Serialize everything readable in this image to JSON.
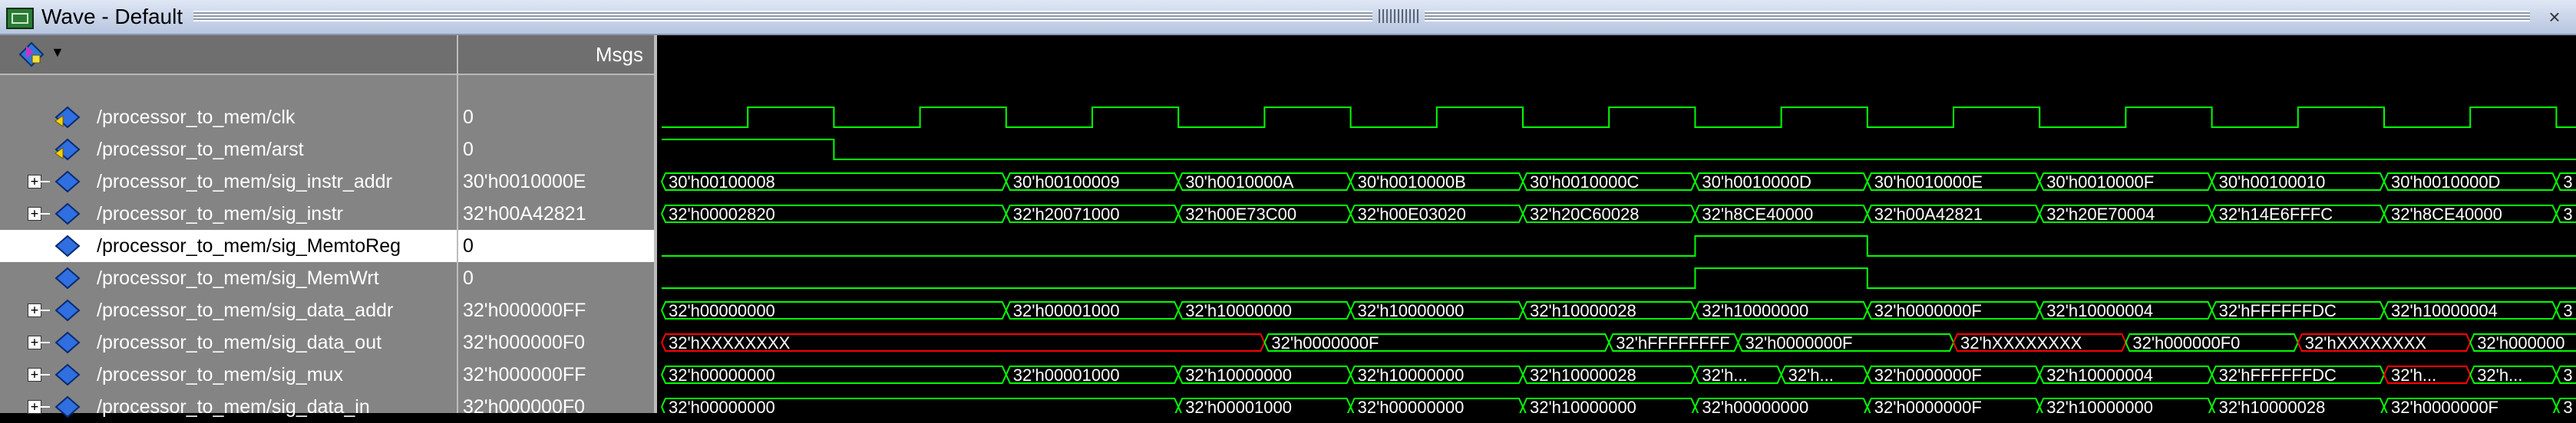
{
  "window": {
    "title": "Wave - Default"
  },
  "header": {
    "values_label": "Msgs"
  },
  "signals": [
    {
      "name": "/processor_to_mem/clk",
      "value": "0",
      "kind": "bit",
      "expandable": false,
      "icon": "signal-input-icon"
    },
    {
      "name": "/processor_to_mem/arst",
      "value": "0",
      "kind": "bit",
      "expandable": false,
      "icon": "signal-input-icon"
    },
    {
      "name": "/processor_to_mem/sig_instr_addr",
      "value": "30'h0010000E",
      "kind": "bus",
      "expandable": true,
      "icon": "signal-icon"
    },
    {
      "name": "/processor_to_mem/sig_instr",
      "value": "32'h00A42821",
      "kind": "bus",
      "expandable": true,
      "icon": "signal-icon"
    },
    {
      "name": "/processor_to_mem/sig_MemtoReg",
      "value": "0",
      "kind": "bit",
      "expandable": false,
      "icon": "signal-icon",
      "selected": true
    },
    {
      "name": "/processor_to_mem/sig_MemWrt",
      "value": "0",
      "kind": "bit",
      "expandable": false,
      "icon": "signal-icon"
    },
    {
      "name": "/processor_to_mem/sig_data_addr",
      "value": "32'h000000FF",
      "kind": "bus",
      "expandable": true,
      "icon": "signal-icon"
    },
    {
      "name": "/processor_to_mem/sig_data_out",
      "value": "32'h000000F0",
      "kind": "bus",
      "expandable": true,
      "icon": "signal-icon"
    },
    {
      "name": "/processor_to_mem/sig_mux",
      "value": "32'h000000FF",
      "kind": "bus",
      "expandable": true,
      "icon": "signal-icon"
    },
    {
      "name": "/processor_to_mem/sig_data_in",
      "value": "32'h000000F0",
      "kind": "bus",
      "expandable": true,
      "icon": "signal-icon"
    }
  ],
  "colors": {
    "wave": "#00ff00",
    "undefined": "#ff0000",
    "background": "#000000",
    "panel": "#848484"
  },
  "waves": {
    "clk_period_ns": 20,
    "clk_first_high_ns": 10,
    "visible_end_ns": 230,
    "arst": {
      "high_until_ns": 20
    },
    "sig_MemtoReg": {
      "low": [
        0,
        120
      ],
      "high": [
        120,
        140
      ],
      "low2": [
        140,
        230
      ]
    },
    "sig_MemWrt": {
      "low": [
        0,
        120
      ],
      "high": [
        120,
        140
      ],
      "low2": [
        140,
        230
      ]
    },
    "buses": {
      "sig_instr_addr": [
        {
          "t": 0,
          "v": "30'h00100008"
        },
        {
          "t": 40,
          "v": "30'h00100009"
        },
        {
          "t": 60,
          "v": "30'h0010000A"
        },
        {
          "t": 80,
          "v": "30'h0010000B"
        },
        {
          "t": 100,
          "v": "30'h0010000C"
        },
        {
          "t": 120,
          "v": "30'h0010000D"
        },
        {
          "t": 140,
          "v": "30'h0010000E"
        },
        {
          "t": 160,
          "v": "30'h0010000F"
        },
        {
          "t": 180,
          "v": "30'h00100010"
        },
        {
          "t": 200,
          "v": "30'h0010000D"
        },
        {
          "t": 220,
          "v": "3"
        }
      ],
      "sig_instr": [
        {
          "t": 0,
          "v": "32'h00002820"
        },
        {
          "t": 40,
          "v": "32'h20071000"
        },
        {
          "t": 60,
          "v": "32'h00E73C00"
        },
        {
          "t": 80,
          "v": "32'h00E03020"
        },
        {
          "t": 100,
          "v": "32'h20C60028"
        },
        {
          "t": 120,
          "v": "32'h8CE40000"
        },
        {
          "t": 140,
          "v": "32'h00A42821"
        },
        {
          "t": 160,
          "v": "32'h20E70004"
        },
        {
          "t": 180,
          "v": "32'h14E6FFFC"
        },
        {
          "t": 200,
          "v": "32'h8CE40000"
        },
        {
          "t": 220,
          "v": "3"
        }
      ],
      "sig_data_addr": [
        {
          "t": 0,
          "v": "32'h00000000"
        },
        {
          "t": 40,
          "v": "32'h00001000"
        },
        {
          "t": 60,
          "v": "32'h10000000"
        },
        {
          "t": 80,
          "v": "32'h10000000"
        },
        {
          "t": 100,
          "v": "32'h10000028"
        },
        {
          "t": 120,
          "v": "32'h10000000"
        },
        {
          "t": 140,
          "v": "32'h0000000F"
        },
        {
          "t": 160,
          "v": "32'h10000004"
        },
        {
          "t": 180,
          "v": "32'hFFFFFFDC"
        },
        {
          "t": 200,
          "v": "32'h10000004"
        },
        {
          "t": 220,
          "v": "3"
        }
      ],
      "sig_data_out": [
        {
          "t": 0,
          "v": "32'hXXXXXXXX",
          "x": true
        },
        {
          "t": 70,
          "v": "32'h0000000F"
        },
        {
          "t": 110,
          "v": "32'hFFFFFFFF"
        },
        {
          "t": 125,
          "v": "32'h0000000F"
        },
        {
          "t": 150,
          "v": "32'hXXXXXXXX",
          "x": true
        },
        {
          "t": 170,
          "v": "32'h000000F0"
        },
        {
          "t": 190,
          "v": "32'hXXXXXXXX",
          "x": true
        },
        {
          "t": 210,
          "v": "32'h000000"
        }
      ],
      "sig_mux": [
        {
          "t": 0,
          "v": "32'h00000000"
        },
        {
          "t": 40,
          "v": "32'h00001000"
        },
        {
          "t": 60,
          "v": "32'h10000000"
        },
        {
          "t": 80,
          "v": "32'h10000000"
        },
        {
          "t": 100,
          "v": "32'h10000028"
        },
        {
          "t": 120,
          "v": "32'h..."
        },
        {
          "t": 130,
          "v": "32'h..."
        },
        {
          "t": 140,
          "v": "32'h0000000F"
        },
        {
          "t": 160,
          "v": "32'h10000004"
        },
        {
          "t": 180,
          "v": "32'hFFFFFFDC"
        },
        {
          "t": 200,
          "v": "32'h...",
          "x": true
        },
        {
          "t": 210,
          "v": "32'h..."
        },
        {
          "t": 220,
          "v": "3"
        }
      ],
      "sig_data_in": [
        {
          "t": 0,
          "v": "32'h00000000"
        },
        {
          "t": 60,
          "v": "32'h00001000"
        },
        {
          "t": 80,
          "v": "32'h00000000"
        },
        {
          "t": 100,
          "v": "32'h10000000"
        },
        {
          "t": 120,
          "v": "32'h00000000"
        },
        {
          "t": 140,
          "v": "32'h0000000F"
        },
        {
          "t": 160,
          "v": "32'h10000000"
        },
        {
          "t": 180,
          "v": "32'h10000028"
        },
        {
          "t": 200,
          "v": "32'h0000000F"
        },
        {
          "t": 220,
          "v": "3"
        }
      ]
    }
  }
}
